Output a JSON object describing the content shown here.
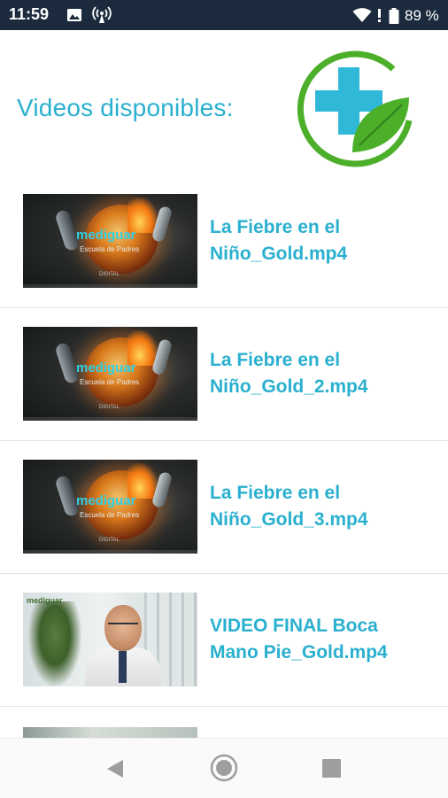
{
  "status_bar": {
    "time": "11:59",
    "battery_percent": "89 %",
    "icons": [
      "photo-icon",
      "antenna-icon",
      "wifi-icon",
      "no-sim-icon",
      "battery-icon"
    ]
  },
  "header": {
    "title": "Videos disponibles:",
    "logo_icon": "medical-cross-leaf-logo"
  },
  "videos": [
    {
      "title": "La Fiebre en el Niño_Gold.mp4",
      "thumb_brand": "mediguar",
      "thumb_sub": "Escuela de Padres",
      "thumb_small": "DIGITAL"
    },
    {
      "title": "La Fiebre en el Niño_Gold_2.mp4",
      "thumb_brand": "mediguar",
      "thumb_sub": "Escuela de Padres",
      "thumb_small": "DIGITAL"
    },
    {
      "title": "La Fiebre en el Niño_Gold_3.mp4",
      "thumb_brand": "mediguar",
      "thumb_sub": "Escuela de Padres",
      "thumb_small": "DIGITAL"
    },
    {
      "title": "VIDEO FINAL Boca Mano Pie_Gold.mp4",
      "thumb_brand": "mediguar"
    }
  ],
  "nav_bar": {
    "icons": [
      "back-icon",
      "home-icon",
      "recents-icon"
    ]
  },
  "colors": {
    "accent": "#2ab0cf",
    "status_bar": "#1b2b3d",
    "logo_green": "#4caf2a",
    "logo_blue": "#2fb8d8"
  }
}
